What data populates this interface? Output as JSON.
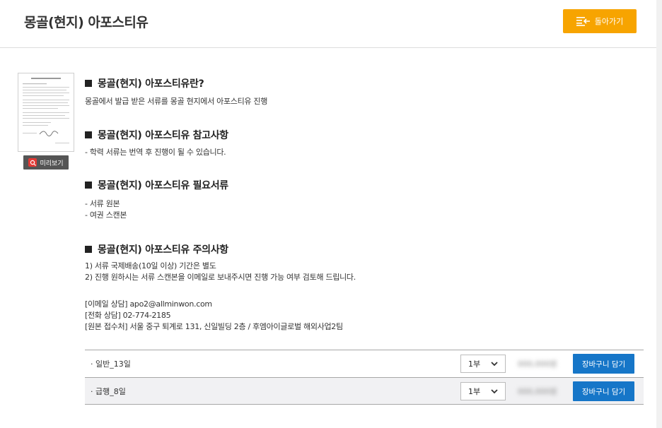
{
  "header": {
    "title": "몽골(현지) 아포스티유",
    "back_label": "돌아가기"
  },
  "preview": {
    "label": "미리보기"
  },
  "sections": [
    {
      "title": "몽골(현지) 아포스티유란?",
      "lines": [
        "몽골에서 발급 받은 서류를 몽골 현지에서 아포스티유 진행"
      ]
    },
    {
      "title": "몽골(현지) 아포스티유 참고사항",
      "lines": [
        "- 학력 서류는 번역 후 진행이 될 수 있습니다."
      ]
    },
    {
      "title": "몽골(현지) 아포스티유 필요서류",
      "lines": [
        "- 서류 원본",
        "- 여권 스캔본"
      ]
    },
    {
      "title": "몽골(현지) 아포스티유 주의사항",
      "lines": [
        "1) 서류 국제배송(10일 이상) 기간은 별도",
        "2) 진행 원하시는 서류 스캔본을 이메일로 보내주시면 진행 가능 여부 검토해 드립니다."
      ]
    }
  ],
  "contact": [
    "[이메일 상담] apo2@allminwon.com",
    "[전화 상담] 02-774-2185",
    "[원본 접수처] 서울 중구 퇴계로 131, 신일빌딩 2층 / 후엠아이글로벌 해외사업2팀"
  ],
  "options": [
    {
      "label": "· 일반_13일",
      "qty": "1부",
      "price": "000,000원",
      "cart_label": "장바구니 담기"
    },
    {
      "label": "· 급행_8일",
      "qty": "1부",
      "price": "000,000원",
      "cart_label": "장바구니 담기"
    }
  ],
  "colors": {
    "back_button": "#f7a400",
    "cart_button": "#1676c8"
  }
}
